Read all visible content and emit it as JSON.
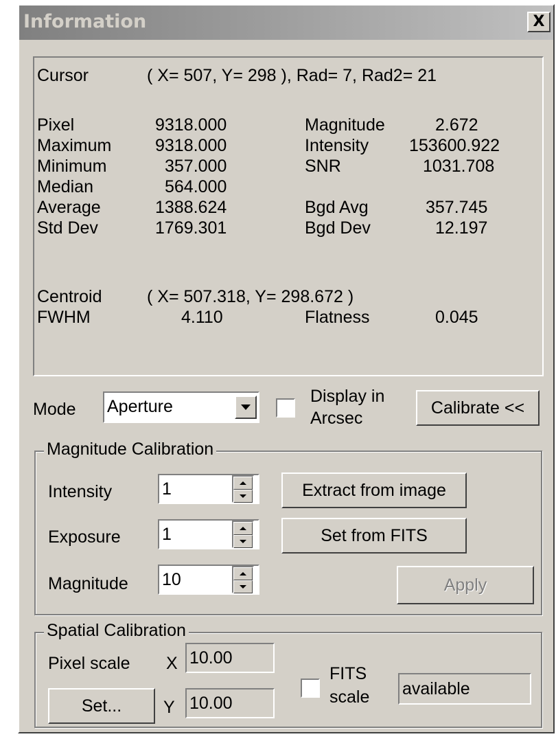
{
  "window": {
    "title": "Information",
    "close_label": "X"
  },
  "info": {
    "cursor_label": "Cursor",
    "cursor_value": "( X=  507, Y=  298 ), Rad=  7, Rad2= 21",
    "stats_left": [
      {
        "label": "Pixel",
        "value": "9318.000"
      },
      {
        "label": "Maximum",
        "value": "9318.000"
      },
      {
        "label": "Minimum",
        "value": "357.000"
      },
      {
        "label": "Median",
        "value": "564.000"
      },
      {
        "label": "Average",
        "value": "1388.624"
      },
      {
        "label": "Std Dev",
        "value": "1769.301"
      }
    ],
    "stats_right": [
      {
        "label": "Magnitude",
        "value": "2.672"
      },
      {
        "label": "Intensity",
        "value": "153600.922"
      },
      {
        "label": "SNR",
        "value": "1031.708"
      },
      {
        "label": "Bgd Avg",
        "value": "357.745"
      },
      {
        "label": "Bgd Dev",
        "value": "12.197"
      }
    ],
    "centroid_label": "Centroid",
    "centroid_value": "( X=  507.318, Y=  298.672 )",
    "fwhm_label": "FWHM",
    "fwhm_value": "4.110",
    "flatness_label": "Flatness",
    "flatness_value": "0.045"
  },
  "controls": {
    "mode_label": "Mode",
    "mode_value": "Aperture",
    "display_arcsec_line1": "Display in",
    "display_arcsec_line2": "Arcsec",
    "display_arcsec_checked": false,
    "calibrate_label": "Calibrate <<"
  },
  "magnitude_calibration": {
    "group_label": "Magnitude Calibration",
    "intensity_label": "Intensity",
    "intensity_value": "1",
    "exposure_label": "Exposure",
    "exposure_value": "1",
    "magnitude_label": "Magnitude",
    "magnitude_value": "10",
    "extract_label": "Extract from image",
    "set_fits_label": "Set from FITS",
    "apply_label": "Apply"
  },
  "spatial_calibration": {
    "group_label": "Spatial Calibration",
    "pixel_scale_label": "Pixel scale",
    "x_label": "X",
    "x_value": "10.00",
    "y_label": "Y",
    "y_value": "10.00",
    "set_label": "Set...",
    "fits_scale_line1": "FITS",
    "fits_scale_line2": "scale",
    "fits_scale_checked": false,
    "fits_status": "available"
  }
}
